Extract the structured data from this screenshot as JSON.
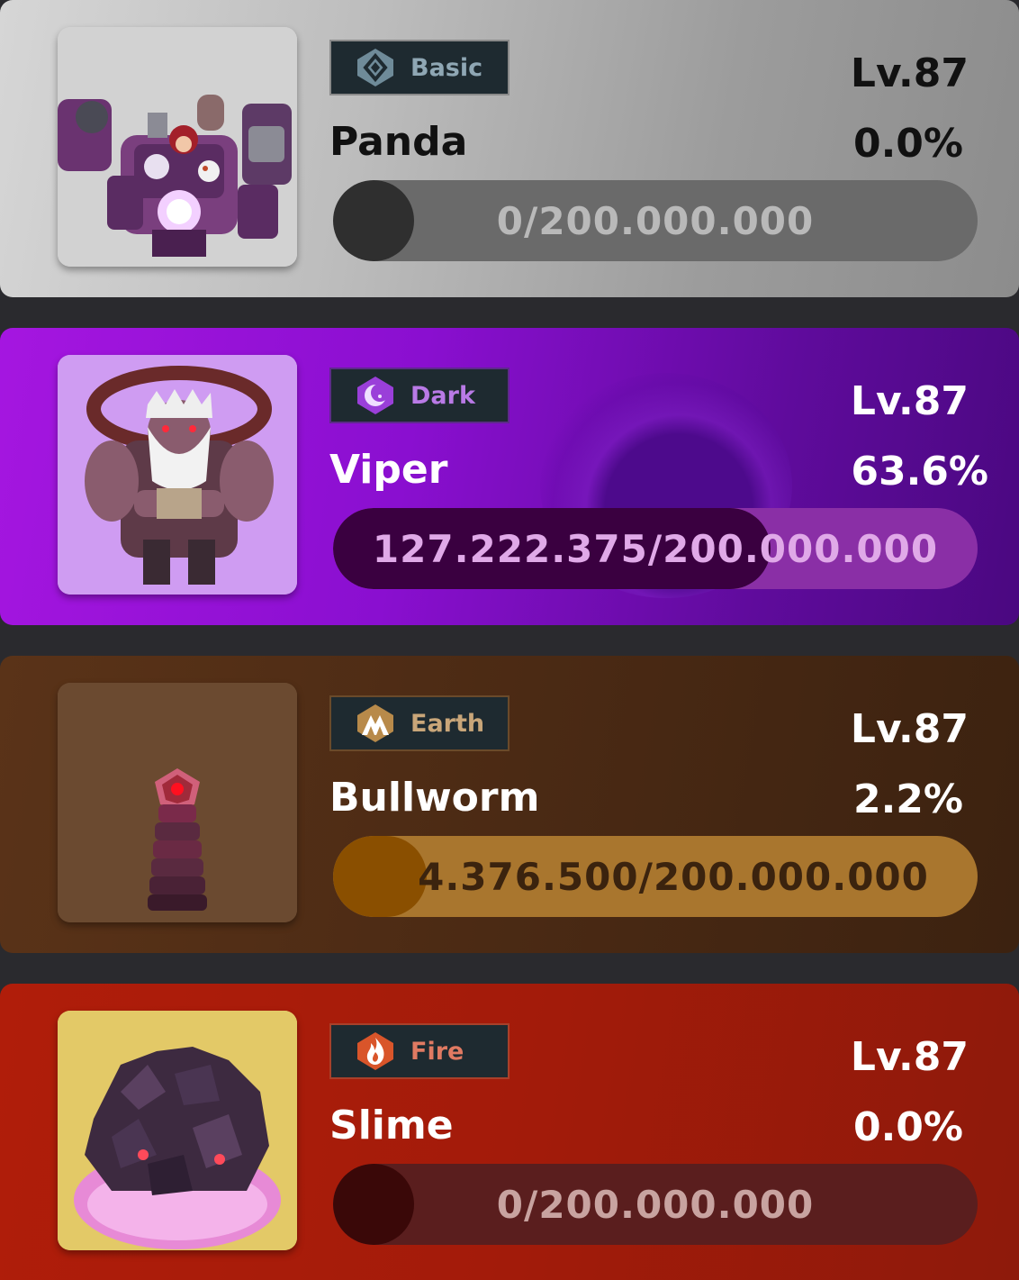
{
  "bosses": [
    {
      "element": "Basic",
      "icon": "basic-element-icon",
      "name": "Panda",
      "level": "Lv.87",
      "percent": "0.0%",
      "progress_text": "0/200.000.000",
      "progress_fraction": 0.0
    },
    {
      "element": "Dark",
      "icon": "dark-moon-icon",
      "name": "Viper",
      "level": "Lv.87",
      "percent": "63.6%",
      "progress_text": "127.222.375/200.000.000",
      "progress_fraction": 0.636
    },
    {
      "element": "Earth",
      "icon": "earth-mountain-icon",
      "name": "Bullworm",
      "level": "Lv.87",
      "percent": "2.2%",
      "progress_text": "4.376.500/200.000.000",
      "progress_fraction": 0.022
    },
    {
      "element": "Fire",
      "icon": "fire-flame-icon",
      "name": "Slime",
      "level": "Lv.87",
      "percent": "0.0%",
      "progress_text": "0/200.000.000",
      "progress_fraction": 0.0
    }
  ],
  "colors": {
    "basic": "#9c9c9c",
    "dark": "#8a0fd0",
    "earth": "#4b2a14",
    "fire": "#a31b0a"
  }
}
